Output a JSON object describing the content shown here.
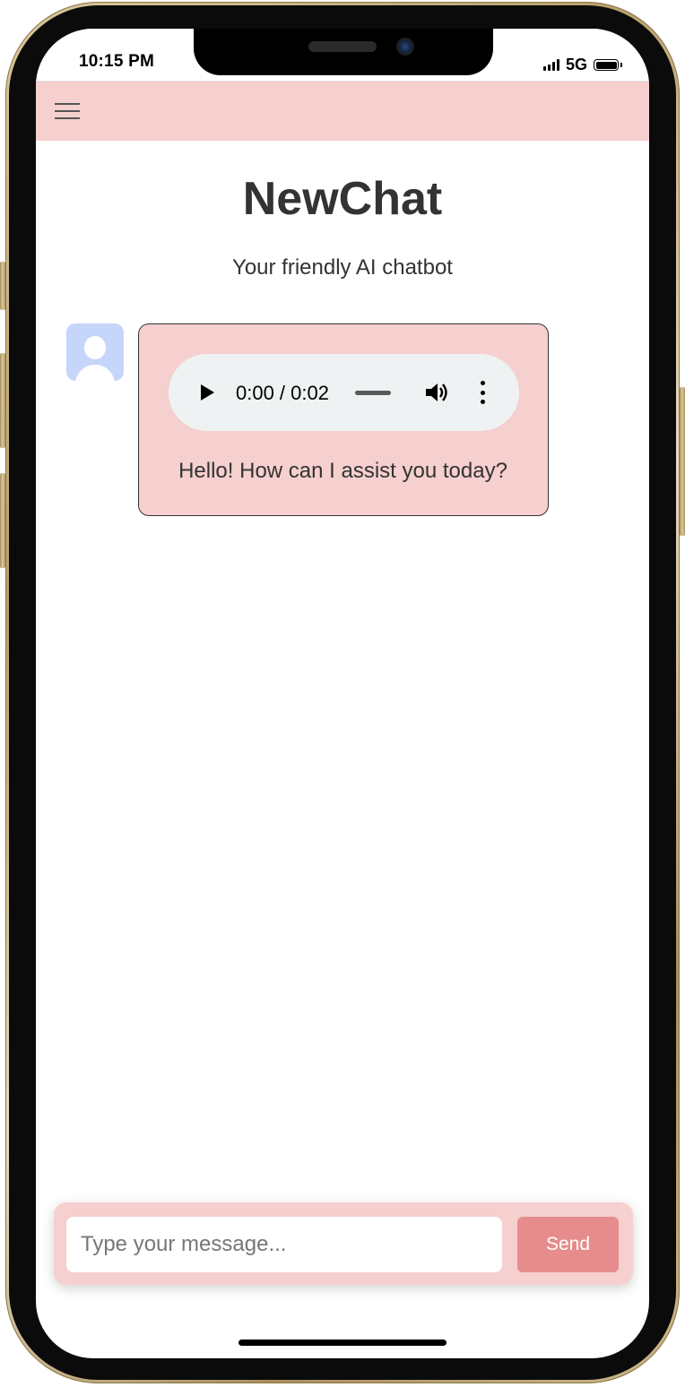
{
  "status_bar": {
    "time": "10:15 PM",
    "network": "5G",
    "icons": [
      "signal-icon",
      "battery-icon"
    ]
  },
  "header": {
    "menu_icon": "hamburger-menu-icon"
  },
  "app": {
    "title": "NewChat",
    "subtitle": "Your friendly AI chatbot"
  },
  "messages": [
    {
      "sender_avatar": "avatar-icon",
      "audio": {
        "time": "0:00 / 0:02",
        "progress": 0,
        "controls": [
          "play-icon",
          "volume-icon",
          "more-options-icon"
        ]
      },
      "text": "Hello! How can I assist you today?"
    }
  ],
  "composer": {
    "placeholder": "Type your message...",
    "value": "",
    "send_label": "Send"
  },
  "colors": {
    "header_bg": "#f6cfcf",
    "bubble_bg": "#f6cfcf",
    "send_button": "#e68c8c",
    "avatar_bg": "#c6d6fb",
    "text": "#333333"
  }
}
